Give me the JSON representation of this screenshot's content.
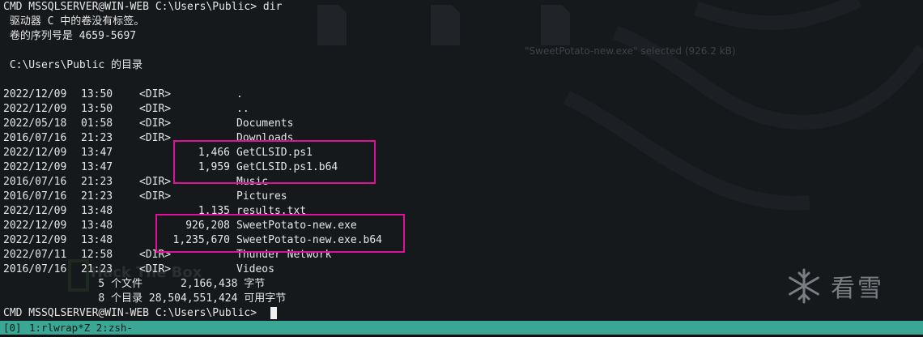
{
  "terminal": {
    "command_line": "CMD MSSQLSERVER@WIN-WEB C:\\Users\\Public> dir",
    "volume_line": " 驱动器 C 中的卷没有标签。",
    "serial_line": " 卷的序列号是 4659-5697",
    "directory_line": " C:\\Users\\Public 的目录",
    "entries": [
      {
        "date": "2022/12/09",
        "time": "13:50",
        "dir": "<DIR>",
        "size": "",
        "name": "."
      },
      {
        "date": "2022/12/09",
        "time": "13:50",
        "dir": "<DIR>",
        "size": "",
        "name": ".."
      },
      {
        "date": "2022/05/18",
        "time": "01:58",
        "dir": "<DIR>",
        "size": "",
        "name": "Documents"
      },
      {
        "date": "2016/07/16",
        "time": "21:23",
        "dir": "<DIR>",
        "size": "",
        "name": "Downloads"
      },
      {
        "date": "2022/12/09",
        "time": "13:47",
        "dir": "",
        "size": "1,466",
        "name": "GetCLSID.ps1"
      },
      {
        "date": "2022/12/09",
        "time": "13:47",
        "dir": "",
        "size": "1,959",
        "name": "GetCLSID.ps1.b64"
      },
      {
        "date": "2016/07/16",
        "time": "21:23",
        "dir": "<DIR>",
        "size": "",
        "name": "Music"
      },
      {
        "date": "2016/07/16",
        "time": "21:23",
        "dir": "<DIR>",
        "size": "",
        "name": "Pictures"
      },
      {
        "date": "2022/12/09",
        "time": "13:48",
        "dir": "",
        "size": "1,135",
        "name": "results.txt"
      },
      {
        "date": "2022/12/09",
        "time": "13:48",
        "dir": "",
        "size": "926,208",
        "name": "SweetPotato-new.exe"
      },
      {
        "date": "2022/12/09",
        "time": "13:48",
        "dir": "",
        "size": "1,235,670",
        "name": "SweetPotato-new.exe.b64"
      },
      {
        "date": "2022/07/11",
        "time": "12:58",
        "dir": "<DIR>",
        "size": "",
        "name": "Thunder Network"
      },
      {
        "date": "2016/07/16",
        "time": "21:23",
        "dir": "<DIR>",
        "size": "",
        "name": "Videos"
      }
    ],
    "summary_files": "               5 个文件      2,166,438 字节",
    "summary_dirs": "               8 个目录 28,504,551,424 可用字节",
    "prompt": "CMD MSSQLSERVER@WIN-WEB C:\\Users\\Public> "
  },
  "tmux": {
    "session": "[0]",
    "windows": "1:rlwrap*Z 2:zsh-"
  },
  "wallpaper": {
    "caption": "\"SweetPotato-new.exe\" selected (926.2 kB)",
    "box_text": "Hack The Box"
  },
  "watermark": {
    "text": "看雪",
    "icon": "snowflake-icon"
  },
  "colors": {
    "highlight": "#e0109a",
    "statusbar": "#3aa795",
    "background": "#16191c"
  }
}
